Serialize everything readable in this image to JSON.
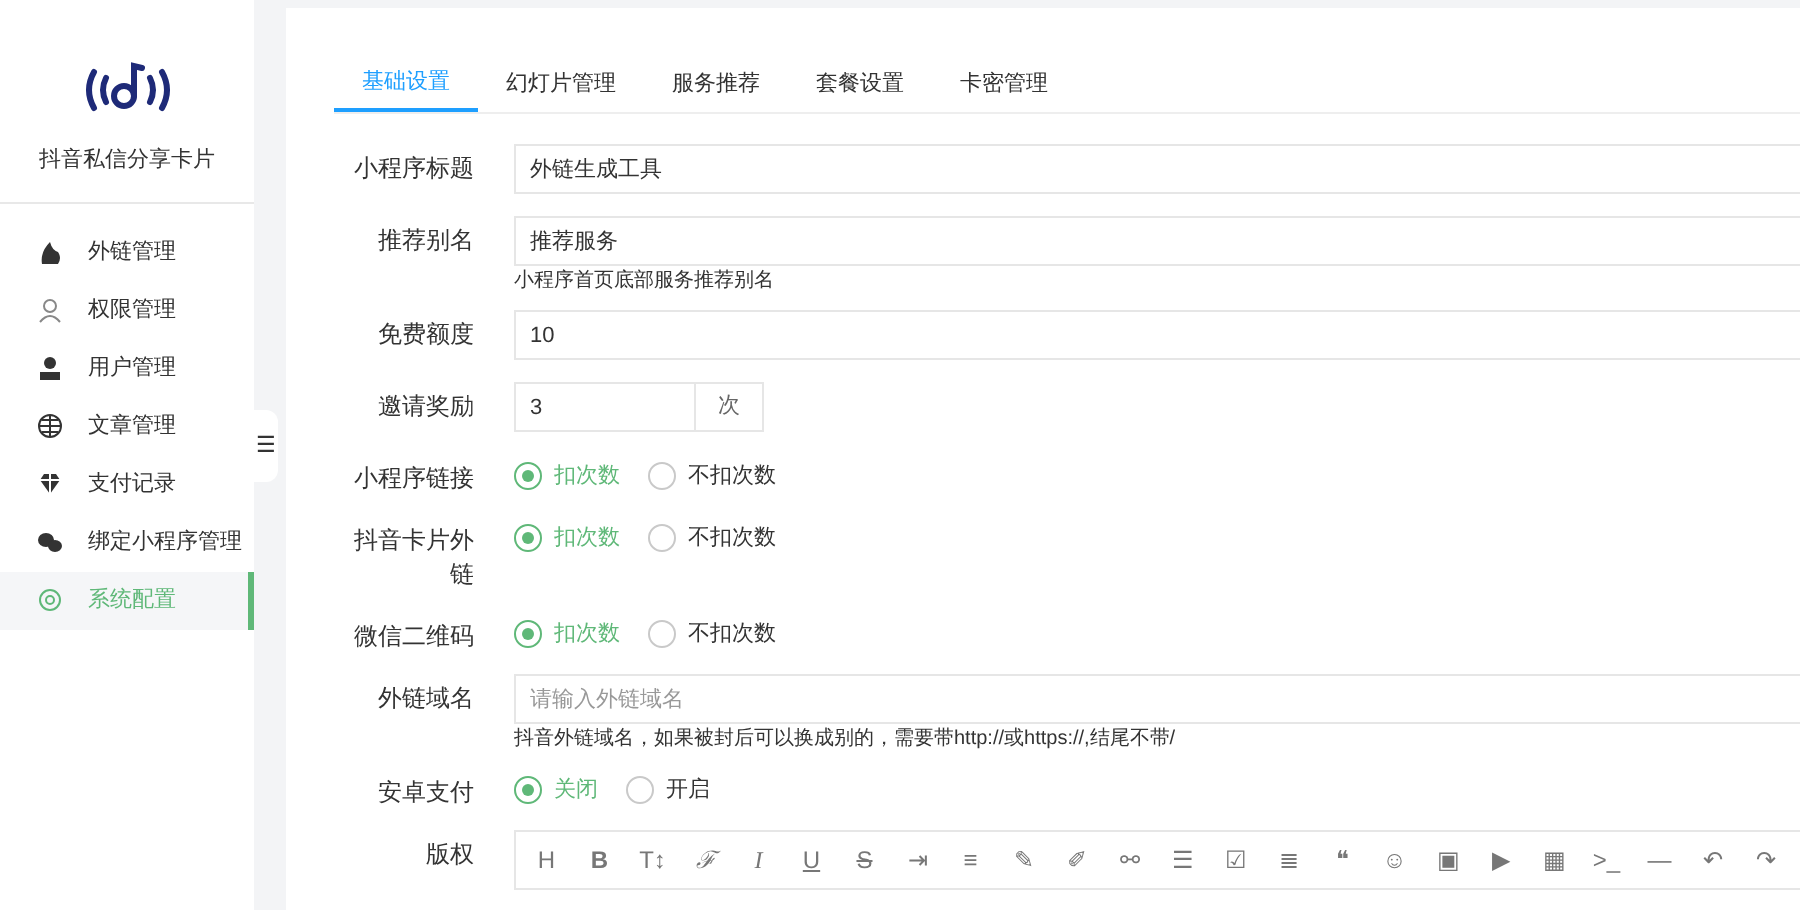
{
  "sidebar": {
    "app_name": "抖音私信分享卡片",
    "collapse_icon": "☰",
    "items": [
      {
        "label": "外链管理",
        "selected": false
      },
      {
        "label": "权限管理",
        "selected": false
      },
      {
        "label": "用户管理",
        "selected": false
      },
      {
        "label": "文章管理",
        "selected": false
      },
      {
        "label": "支付记录",
        "selected": false
      },
      {
        "label": "绑定小程序管理",
        "selected": false
      },
      {
        "label": "系统配置",
        "selected": true
      }
    ]
  },
  "tabs": [
    {
      "label": "基础设置",
      "selected": true
    },
    {
      "label": "幻灯片管理",
      "selected": false
    },
    {
      "label": "服务推荐",
      "selected": false
    },
    {
      "label": "套餐设置",
      "selected": false
    },
    {
      "label": "卡密管理",
      "selected": false
    }
  ],
  "form": {
    "fields": [
      {
        "kind": "input",
        "label": "小程序标题",
        "value": "外链生成工具"
      },
      {
        "kind": "input",
        "label": "推荐别名",
        "value": "推荐服务",
        "hint": "小程序首页底部服务推荐别名"
      },
      {
        "kind": "input",
        "label": "免费额度",
        "value": "10"
      },
      {
        "kind": "addon",
        "label": "邀请奖励",
        "value": "3",
        "addon": "次"
      },
      {
        "kind": "radio",
        "label": "小程序链接",
        "options": [
          {
            "label": "扣次数",
            "selected": true
          },
          {
            "label": "不扣次数",
            "selected": false
          }
        ]
      },
      {
        "kind": "radio",
        "label": "抖音卡片外链",
        "options": [
          {
            "label": "扣次数",
            "selected": true
          },
          {
            "label": "不扣次数",
            "selected": false
          }
        ]
      },
      {
        "kind": "radio",
        "label": "微信二维码",
        "options": [
          {
            "label": "扣次数",
            "selected": true
          },
          {
            "label": "不扣次数",
            "selected": false
          }
        ]
      },
      {
        "kind": "input",
        "label": "外链域名",
        "placeholder": "请输入外链域名",
        "hint": "抖音外链域名，如果被封后可以换成别的，需要带http://或https://,结尾不带/"
      },
      {
        "kind": "radio",
        "label": "安卓支付",
        "options": [
          {
            "label": "关闭",
            "selected": true
          },
          {
            "label": "开启",
            "selected": false
          }
        ]
      },
      {
        "kind": "editor",
        "label": "版权",
        "toolbar": [
          "H",
          "B",
          "T↕",
          "ℱ",
          "I",
          "U",
          "S",
          "⇥",
          "≡",
          "✎",
          "✐",
          "⚯",
          "☰",
          "☑",
          "≣",
          "❝",
          "☺",
          "▣",
          "▶",
          "▦",
          ">_",
          "—",
          "↶",
          "↷"
        ]
      }
    ]
  }
}
